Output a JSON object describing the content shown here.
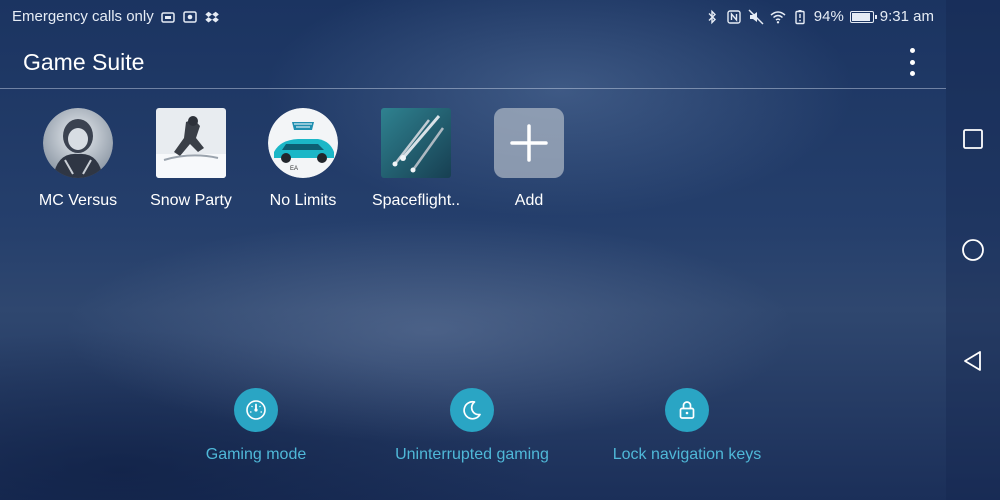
{
  "status_bar": {
    "carrier_text": "Emergency calls only",
    "battery_percent": "94%",
    "battery_level": 0.94,
    "time": "9:31 am",
    "left_icons": [
      "sim-card-icon",
      "photo-icon",
      "dropbox-icon"
    ],
    "right_icons": [
      "bluetooth-icon",
      "nfc-icon",
      "mute-icon",
      "wifi-icon",
      "battery-saver-icon",
      "battery-icon"
    ]
  },
  "app_bar": {
    "title": "Game Suite",
    "menu_icon": "more-vert-icon"
  },
  "games": [
    {
      "label": "MC Versus",
      "icon": "mc-versus-game-icon"
    },
    {
      "label": "Snow Party",
      "icon": "snow-party-game-icon"
    },
    {
      "label": "No Limits",
      "icon": "no-limits-game-icon"
    },
    {
      "label": "Spaceflight..",
      "icon": "spaceflight-game-icon"
    },
    {
      "label": "Add",
      "icon": "plus-icon"
    }
  ],
  "actions": [
    {
      "label": "Gaming mode",
      "icon": "speedometer-icon"
    },
    {
      "label": "Uninterrupted gaming",
      "icon": "moon-icon"
    },
    {
      "label": "Lock navigation keys",
      "icon": "lock-icon"
    }
  ],
  "nav_bar": {
    "buttons": [
      "recents-square-icon",
      "home-circle-icon",
      "back-triangle-icon"
    ]
  },
  "colors": {
    "accent": "#2aa5c4",
    "accent_text": "#4fb8d8",
    "background": "#1c3462",
    "text": "#ffffff"
  }
}
